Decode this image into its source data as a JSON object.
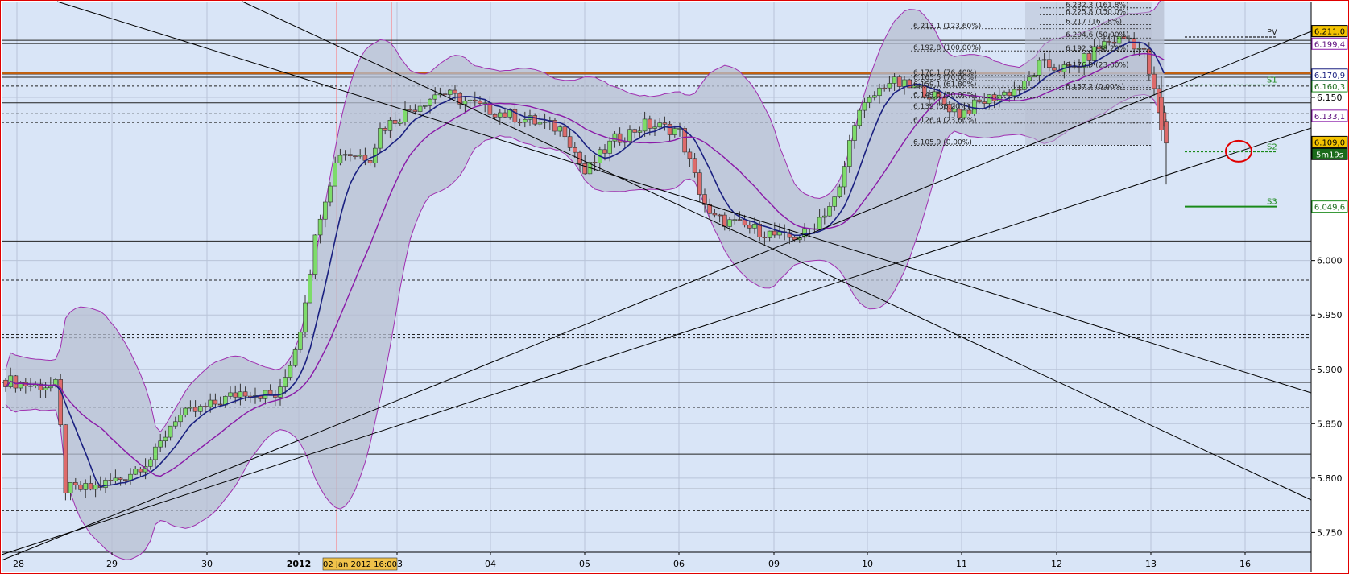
{
  "chart_data": {
    "type": "candlestick",
    "title": "",
    "colors": {
      "background": "#d9e5f7",
      "up": "#7ddc6a",
      "down": "#de6b6b",
      "bollinger_fill": "#b7bfd2",
      "bollinger_line": "#a030b0",
      "ema_fast": "#1a2080",
      "ema_slow": "#8a1aa8",
      "orange_line": "#c06010",
      "trend_line": "#000000",
      "cursor": "#ff7070",
      "highlight_circle": "#e00000"
    },
    "y_axis": {
      "range": [
        5.735,
        6.25
      ],
      "ticks": [
        "6.150",
        "6.000",
        "5.950",
        "5.900",
        "5.850",
        "5.800",
        "5.750"
      ],
      "tick_values": [
        6.15,
        6.0,
        5.95,
        5.9,
        5.85,
        5.8,
        5.75
      ]
    },
    "x_axis": {
      "labels": [
        "28",
        "29",
        "30",
        "2012",
        "03",
        "04",
        "05",
        "06",
        "09",
        "10",
        "11",
        "12",
        "13",
        "16"
      ],
      "cursor_label": "02 Jan 2012 16:00"
    },
    "price_tags": [
      {
        "label": "6.211,0",
        "value": 6.211,
        "style": "yellow"
      },
      {
        "label": "6.199,4",
        "value": 6.1994,
        "style": "purple"
      },
      {
        "label": "6.170,9",
        "value": 6.1709,
        "style": "navy"
      },
      {
        "label": "6.160,3",
        "value": 6.1603,
        "style": "green"
      },
      {
        "label": "6.133,1",
        "value": 6.1331,
        "style": "purple"
      },
      {
        "label": "6.109,0",
        "value": 6.109,
        "style": "orange"
      },
      {
        "label": "5m19s",
        "value": 6.098,
        "style": "dark"
      },
      {
        "label": "6.049,6",
        "value": 6.0496,
        "style": "green"
      }
    ],
    "fib_levels_top": [
      {
        "label": "6.232,3 (161,8%)",
        "value": 6.2323
      },
      {
        "label": "6.225,8 (150,0%)",
        "value": 6.2258
      },
      {
        "label": "6.217 (161,8%)",
        "value": 6.217
      },
      {
        "label": "6.204,6 (50,00%)",
        "value": 6.2046
      },
      {
        "label": "6.192,3 (38,20%)",
        "value": 6.1923
      },
      {
        "label": "6.176,9 (23,60%)",
        "value": 6.1769
      },
      {
        "label": "6.157,2 (0,00%)",
        "value": 6.1572
      }
    ],
    "fib_levels_mid": [
      {
        "label": "6.213,1 (123,60%)",
        "value": 6.2131
      },
      {
        "label": "6.192,8 (100,00%)",
        "value": 6.1928
      },
      {
        "label": "6.170,1 (76,40%)",
        "value": 6.1701
      },
      {
        "label": "6.165,5 (70,00%)",
        "value": 6.1655
      },
      {
        "label": "6.159,1 (61,80%)",
        "value": 6.1591
      },
      {
        "label": "6.149,5 (50,00%)",
        "value": 6.1495
      },
      {
        "label": "6.139 (38,20%)",
        "value": 6.139
      },
      {
        "label": "6.126,4 (23,60%)",
        "value": 6.1264
      },
      {
        "label": "6.105,9 (0,00%)",
        "value": 6.1059
      }
    ],
    "pivots": [
      {
        "label": "PV",
        "value": 6.2055
      },
      {
        "label": "S1",
        "value": 6.1615
      },
      {
        "label": "S2",
        "value": 6.1
      },
      {
        "label": "S3",
        "value": 6.0496
      }
    ],
    "horizontal_solid": [
      6.1995,
      6.2025,
      6.1715,
      6.1685,
      6.145,
      6.018,
      5.888,
      5.822,
      5.79
    ],
    "horizontal_dashed": [
      6.1605,
      6.135,
      6.127,
      5.982,
      5.932,
      5.929,
      5.865,
      5.77
    ],
    "candles_sampled": [
      {
        "x": "28",
        "o": 5.89,
        "c": 5.875,
        "h": 5.895,
        "l": 5.77
      },
      {
        "x": "29",
        "o": 5.78,
        "c": 5.79,
        "h": 5.805,
        "l": 5.765
      },
      {
        "x": "30",
        "o": 5.85,
        "c": 5.875,
        "h": 5.885,
        "l": 5.84
      },
      {
        "x": "2012",
        "o": 5.865,
        "c": 5.88,
        "h": 5.895,
        "l": 5.855
      },
      {
        "x": "03",
        "o": 6.11,
        "c": 6.13,
        "h": 6.16,
        "l": 6.075
      },
      {
        "x": "04",
        "o": 6.12,
        "c": 6.11,
        "h": 6.14,
        "l": 6.095
      },
      {
        "x": "05",
        "o": 6.1,
        "c": 6.08,
        "h": 6.12,
        "l": 6.035
      },
      {
        "x": "06",
        "o": 6.115,
        "c": 6.13,
        "h": 6.14,
        "l": 6.095
      },
      {
        "x": "09",
        "o": 6.03,
        "c": 6.045,
        "h": 6.06,
        "l": 6.0
      },
      {
        "x": "10",
        "o": 6.06,
        "c": 6.09,
        "h": 6.11,
        "l": 6.05
      },
      {
        "x": "11",
        "o": 6.15,
        "c": 6.12,
        "h": 6.165,
        "l": 6.11
      },
      {
        "x": "12",
        "o": 6.16,
        "c": 6.175,
        "h": 6.185,
        "l": 6.15
      },
      {
        "x": "13",
        "o": 6.2,
        "c": 6.11,
        "h": 6.215,
        "l": 6.07
      }
    ]
  }
}
